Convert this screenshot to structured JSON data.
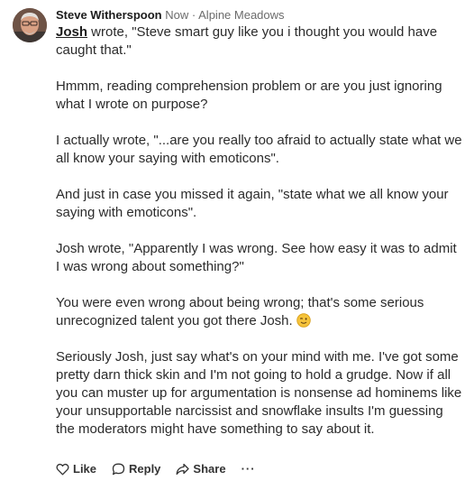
{
  "post": {
    "author": "Steve Witherspoon",
    "meta_time": "Now",
    "meta_separator": "·",
    "meta_location": "Alpine Meadows",
    "paragraphs": {
      "p1_mention": "Josh",
      "p1_rest": " wrote, \"Steve smart guy like you i thought you would have caught that.\"",
      "p2": "Hmmm, reading comprehension problem or are you just ignoring what I wrote on purpose?",
      "p3": "I actually wrote, \"...are you really too afraid to actually state what we all know your saying with emoticons\".",
      "p4": "And just in case you missed it again, \"state what we all know your saying with emoticons\".",
      "p5": "Josh wrote, \"Apparently I was wrong. See how easy it was to admit I was wrong about something?\"",
      "p6": "You were even wrong about being wrong; that's some serious unrecognized talent you got there Josh.",
      "p7": "Seriously Josh, just say what's on your mind with me. I've got some pretty darn thick skin and I'm not going to hold a grudge. Now if all you can muster up for argumentation is nonsense ad hominems like your unsupportable narcissist and snowflake insults I'm guessing the moderators might have something to say about it."
    },
    "emoji_icon": "winking-face-icon"
  },
  "actions": {
    "like_label": "Like",
    "reply_label": "Reply",
    "share_label": "Share",
    "more_label": "···"
  },
  "colors": {
    "text": "#2b2b2b",
    "meta": "#6b6b6b",
    "emoji": "#f5c33b"
  }
}
